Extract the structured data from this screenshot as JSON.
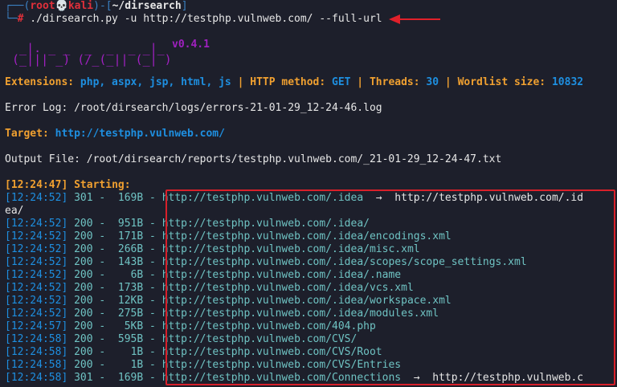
{
  "prompt": {
    "open": "┌──(",
    "user": "root",
    "skull": "💀",
    "host": "kali",
    "mid": ")-[",
    "path": "~/dirsearch",
    "close": "]",
    "second_prefix": "└─",
    "hash": "#",
    "command": " ./dirsearch.py -u http://testphp.vulnweb.com/ --full-url"
  },
  "logo": {
    "line1": "  _|. _ _  _  _  _ _|_",
    "line2": " (_||| _) (/_(_|| (_| )",
    "version": "v0.4.1"
  },
  "config": {
    "ext_label": "Extensions: ",
    "ext_value": "php, aspx, jsp, html, js",
    "sep": " | ",
    "method_label": "HTTP method: ",
    "method_value": "GET",
    "threads_label": "Threads: ",
    "threads_value": "30",
    "wordlist_label": "Wordlist size: ",
    "wordlist_value": "10832"
  },
  "error_log": "Error Log: /root/dirsearch/logs/errors-21-01-29_12-24-46.log",
  "target_label": "Target: ",
  "target_value": "http://testphp.vulnweb.com/",
  "output_file": "Output File: /root/dirsearch/reports/testphp.vulnweb.com/_21-01-29_12-24-47.txt",
  "starting_ts": "[12:24:47]",
  "starting_label": " Starting:",
  "rows": [
    {
      "ts": "[12:24:52]",
      "code": "301",
      "size": "169B",
      "url": "http://testphp.vulnweb.com/.idea",
      "redir": "  →  http://testphp.vulnweb.com/.id"
    },
    {
      "ts": "",
      "code": "",
      "size": "",
      "url": "",
      "redir": "ea/"
    },
    {
      "ts": "[12:24:52]",
      "code": "200",
      "size": "951B",
      "url": "http://testphp.vulnweb.com/.idea/",
      "redir": ""
    },
    {
      "ts": "[12:24:52]",
      "code": "200",
      "size": "171B",
      "url": "http://testphp.vulnweb.com/.idea/encodings.xml",
      "redir": ""
    },
    {
      "ts": "[12:24:52]",
      "code": "200",
      "size": "266B",
      "url": "http://testphp.vulnweb.com/.idea/misc.xml",
      "redir": ""
    },
    {
      "ts": "[12:24:52]",
      "code": "200",
      "size": "143B",
      "url": "http://testphp.vulnweb.com/.idea/scopes/scope_settings.xml",
      "redir": ""
    },
    {
      "ts": "[12:24:52]",
      "code": "200",
      "size": "6B",
      "url": "http://testphp.vulnweb.com/.idea/.name",
      "redir": ""
    },
    {
      "ts": "[12:24:52]",
      "code": "200",
      "size": "173B",
      "url": "http://testphp.vulnweb.com/.idea/vcs.xml",
      "redir": ""
    },
    {
      "ts": "[12:24:52]",
      "code": "200",
      "size": "12KB",
      "url": "http://testphp.vulnweb.com/.idea/workspace.xml",
      "redir": ""
    },
    {
      "ts": "[12:24:52]",
      "code": "200",
      "size": "275B",
      "url": "http://testphp.vulnweb.com/.idea/modules.xml",
      "redir": ""
    },
    {
      "ts": "[12:24:57]",
      "code": "200",
      "size": "5KB",
      "url": "http://testphp.vulnweb.com/404.php",
      "redir": ""
    },
    {
      "ts": "[12:24:58]",
      "code": "200",
      "size": "595B",
      "url": "http://testphp.vulnweb.com/CVS/",
      "redir": ""
    },
    {
      "ts": "[12:24:58]",
      "code": "200",
      "size": "1B",
      "url": "http://testphp.vulnweb.com/CVS/Root",
      "redir": ""
    },
    {
      "ts": "[12:24:58]",
      "code": "200",
      "size": "1B",
      "url": "http://testphp.vulnweb.com/CVS/Entries",
      "redir": ""
    },
    {
      "ts": "[12:24:58]",
      "code": "301",
      "size": "169B",
      "url": "http://testphp.vulnweb.com/Connections",
      "redir": "  →  http://testphp.vulnweb.c"
    }
  ],
  "colors": {
    "background": "#1d1f2b",
    "accent_red": "#d8202a",
    "prompt_blue": "#3b82c4",
    "cyan": "#6fc3c3",
    "orange": "#f0a030",
    "purple": "#a020c0"
  }
}
